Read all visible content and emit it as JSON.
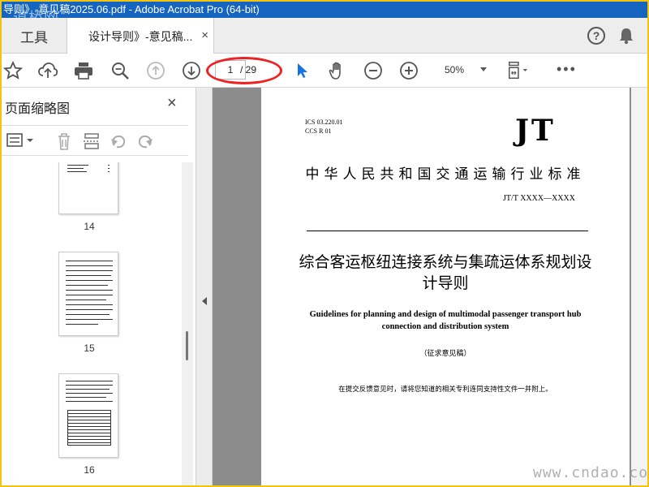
{
  "window": {
    "title": "导则》-意见稿2025.06.pdf - Adobe Acrobat Pro (64-bit)",
    "watermark_top": "道桥网"
  },
  "tabs": {
    "tools_label": "工具",
    "doc_tab_label": "设计导则》-意见稿...",
    "close_glyph": "×"
  },
  "toolbar": {
    "current_page": "1",
    "total_pages": "/ 29",
    "zoom": "50%",
    "more": "•••",
    "icons": [
      "star-icon",
      "cloud-upload-icon",
      "print-icon",
      "zoom-search-icon",
      "prev-page-icon",
      "next-page-icon",
      "select-arrow-icon",
      "hand-icon",
      "zoom-out-icon",
      "zoom-in-icon",
      "fit-page-icon"
    ]
  },
  "left_panel": {
    "title": "页面缩略图",
    "close_glyph": "×",
    "thumbnails": [
      {
        "page": "14"
      },
      {
        "page": "15"
      },
      {
        "page": "16"
      }
    ]
  },
  "document": {
    "ics": "ICS  03.220.01",
    "ccs": "CCS R 01",
    "logo": "JT",
    "std_title": "中华人民共和国交通运输行业标准",
    "std_number": "JT/T XXXX—XXXX",
    "cn_title": "综合客运枢纽连接系统与集疏运体系规划设计导则",
    "en_title": "Guidelines for planning and design of multimodal passenger transport hub connection and distribution system",
    "draft_label": "（征求意见稿）",
    "notice": "在提交反馈意见时，请将您知道的相关专利连同支持性文件一并附上。"
  },
  "watermark_bottom": "www.cndao.co",
  "colors": {
    "titlebar": "#1565c0",
    "frame": "#f1c40f",
    "accent_blue": "#1473e6",
    "oval_red": "#e22222"
  }
}
